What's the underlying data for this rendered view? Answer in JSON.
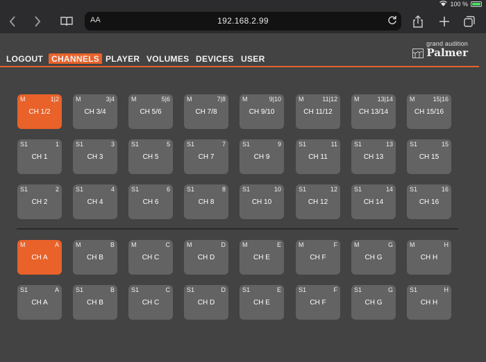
{
  "status": {
    "battery_pct": "100 %",
    "battery_level": 1.0
  },
  "browser": {
    "text_size_label": "AA",
    "url": "192.168.2.99"
  },
  "nav": {
    "items": [
      "LOGOUT",
      "CHANNELS",
      "PLAYER",
      "VOLUMES",
      "DEVICES",
      "USER"
    ],
    "active": "CHANNELS"
  },
  "brand": {
    "subtitle": "grand audition",
    "name": "Palmer"
  },
  "groups": [
    {
      "rows": [
        [
          {
            "mode": "M",
            "num": "1|2",
            "label": "CH 1/2",
            "active": true
          },
          {
            "mode": "M",
            "num": "3|4",
            "label": "CH 3/4",
            "active": false
          },
          {
            "mode": "M",
            "num": "5|6",
            "label": "CH 5/6",
            "active": false
          },
          {
            "mode": "M",
            "num": "7|8",
            "label": "CH 7/8",
            "active": false
          },
          {
            "mode": "M",
            "num": "9|10",
            "label": "CH 9/10",
            "active": false
          },
          {
            "mode": "M",
            "num": "11|12",
            "label": "CH 11/12",
            "active": false
          },
          {
            "mode": "M",
            "num": "13|14",
            "label": "CH 13/14",
            "active": false
          },
          {
            "mode": "M",
            "num": "15|16",
            "label": "CH 15/16",
            "active": false
          }
        ],
        [
          {
            "mode": "S1",
            "num": "1",
            "label": "CH 1",
            "active": false
          },
          {
            "mode": "S1",
            "num": "3",
            "label": "CH 3",
            "active": false
          },
          {
            "mode": "S1",
            "num": "5",
            "label": "CH 5",
            "active": false
          },
          {
            "mode": "S1",
            "num": "7",
            "label": "CH 7",
            "active": false
          },
          {
            "mode": "S1",
            "num": "9",
            "label": "CH 9",
            "active": false
          },
          {
            "mode": "S1",
            "num": "11",
            "label": "CH 11",
            "active": false
          },
          {
            "mode": "S1",
            "num": "13",
            "label": "CH 13",
            "active": false
          },
          {
            "mode": "S1",
            "num": "15",
            "label": "CH 15",
            "active": false
          }
        ],
        [
          {
            "mode": "S1",
            "num": "2",
            "label": "CH 2",
            "active": false
          },
          {
            "mode": "S1",
            "num": "4",
            "label": "CH 4",
            "active": false
          },
          {
            "mode": "S1",
            "num": "6",
            "label": "CH 6",
            "active": false
          },
          {
            "mode": "S1",
            "num": "8",
            "label": "CH 8",
            "active": false
          },
          {
            "mode": "S1",
            "num": "10",
            "label": "CH 10",
            "active": false
          },
          {
            "mode": "S1",
            "num": "12",
            "label": "CH 12",
            "active": false
          },
          {
            "mode": "S1",
            "num": "14",
            "label": "CH 14",
            "active": false
          },
          {
            "mode": "S1",
            "num": "16",
            "label": "CH 16",
            "active": false
          }
        ]
      ]
    },
    {
      "rows": [
        [
          {
            "mode": "M",
            "num": "A",
            "label": "CH A",
            "active": true
          },
          {
            "mode": "M",
            "num": "B",
            "label": "CH B",
            "active": false
          },
          {
            "mode": "M",
            "num": "C",
            "label": "CH C",
            "active": false
          },
          {
            "mode": "M",
            "num": "D",
            "label": "CH D",
            "active": false
          },
          {
            "mode": "M",
            "num": "E",
            "label": "CH E",
            "active": false
          },
          {
            "mode": "M",
            "num": "F",
            "label": "CH F",
            "active": false
          },
          {
            "mode": "M",
            "num": "G",
            "label": "CH G",
            "active": false
          },
          {
            "mode": "M",
            "num": "H",
            "label": "CH H",
            "active": false
          }
        ],
        [
          {
            "mode": "S1",
            "num": "A",
            "label": "CH A",
            "active": false
          },
          {
            "mode": "S1",
            "num": "B",
            "label": "CH B",
            "active": false
          },
          {
            "mode": "S1",
            "num": "C",
            "label": "CH C",
            "active": false
          },
          {
            "mode": "S1",
            "num": "D",
            "label": "CH D",
            "active": false
          },
          {
            "mode": "S1",
            "num": "E",
            "label": "CH E",
            "active": false
          },
          {
            "mode": "S1",
            "num": "F",
            "label": "CH F",
            "active": false
          },
          {
            "mode": "S1",
            "num": "G",
            "label": "CH G",
            "active": false
          },
          {
            "mode": "S1",
            "num": "H",
            "label": "CH H",
            "active": false
          }
        ]
      ]
    }
  ],
  "colors": {
    "accent": "#e8622a",
    "tile": "#636363",
    "background": "#434343"
  }
}
